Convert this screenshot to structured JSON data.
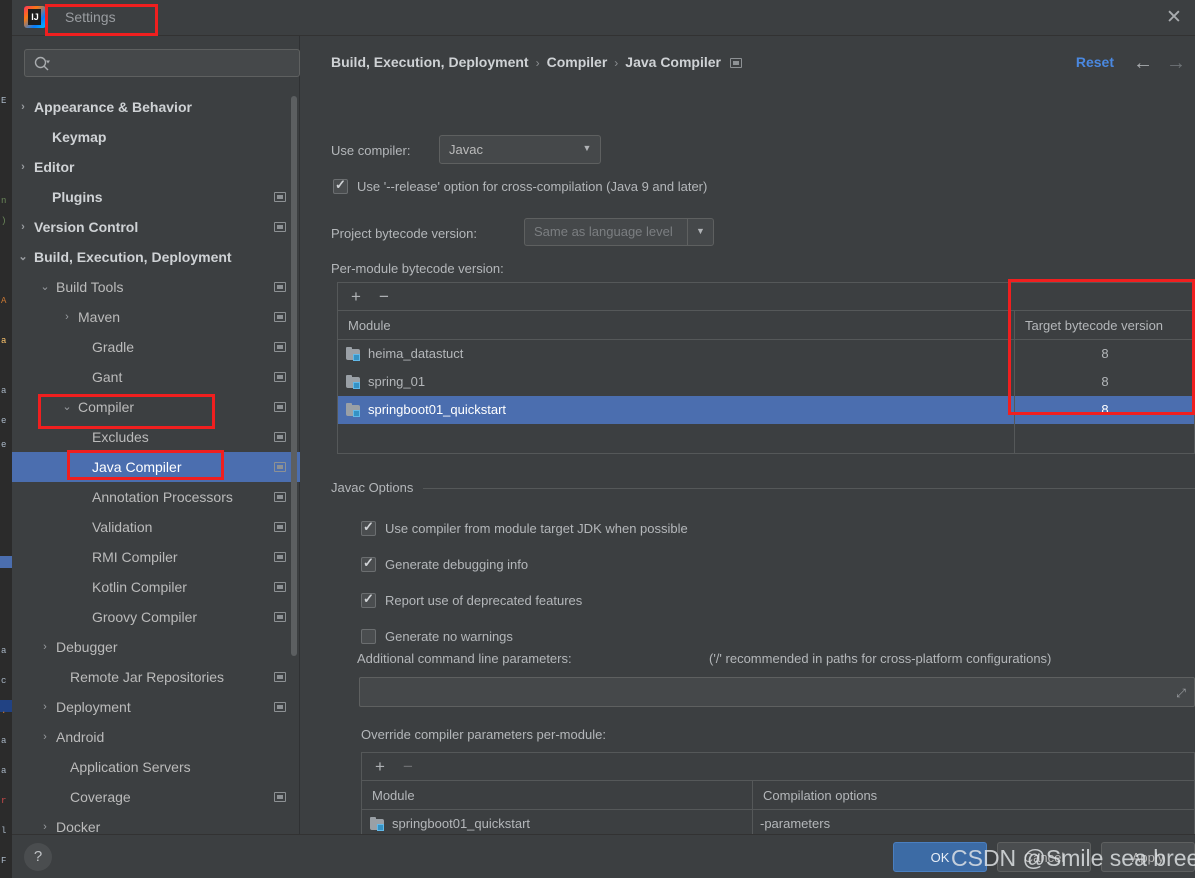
{
  "window": {
    "title": "Settings",
    "logo_text": "IJ",
    "close_label": "✕"
  },
  "sidebar": {
    "search_placeholder": "",
    "items": [
      {
        "label": "Appearance & Behavior",
        "arrow": "›",
        "indent": 22,
        "bold": true,
        "badge": false,
        "selected": false
      },
      {
        "label": "Keymap",
        "arrow": "",
        "indent": 40,
        "bold": true,
        "badge": false,
        "selected": false
      },
      {
        "label": "Editor",
        "arrow": "›",
        "indent": 22,
        "bold": true,
        "badge": false,
        "selected": false
      },
      {
        "label": "Plugins",
        "arrow": "",
        "indent": 40,
        "bold": true,
        "badge": true,
        "selected": false
      },
      {
        "label": "Version Control",
        "arrow": "›",
        "indent": 22,
        "bold": true,
        "badge": true,
        "selected": false
      },
      {
        "label": "Build, Execution, Deployment",
        "arrow": "⌄",
        "indent": 22,
        "bold": true,
        "badge": false,
        "selected": false
      },
      {
        "label": "Build Tools",
        "arrow": "⌄",
        "indent": 44,
        "bold": false,
        "badge": true,
        "selected": false
      },
      {
        "label": "Maven",
        "arrow": "›",
        "indent": 66,
        "bold": false,
        "badge": true,
        "selected": false
      },
      {
        "label": "Gradle",
        "arrow": "",
        "indent": 80,
        "bold": false,
        "badge": true,
        "selected": false
      },
      {
        "label": "Gant",
        "arrow": "",
        "indent": 80,
        "bold": false,
        "badge": true,
        "selected": false
      },
      {
        "label": "Compiler",
        "arrow": "⌄",
        "indent": 66,
        "bold": false,
        "badge": true,
        "selected": false
      },
      {
        "label": "Excludes",
        "arrow": "",
        "indent": 80,
        "bold": false,
        "badge": true,
        "selected": false
      },
      {
        "label": "Java Compiler",
        "arrow": "",
        "indent": 80,
        "bold": false,
        "badge": true,
        "selected": true
      },
      {
        "label": "Annotation Processors",
        "arrow": "",
        "indent": 80,
        "bold": false,
        "badge": true,
        "selected": false
      },
      {
        "label": "Validation",
        "arrow": "",
        "indent": 80,
        "bold": false,
        "badge": true,
        "selected": false
      },
      {
        "label": "RMI Compiler",
        "arrow": "",
        "indent": 80,
        "bold": false,
        "badge": true,
        "selected": false
      },
      {
        "label": "Kotlin Compiler",
        "arrow": "",
        "indent": 80,
        "bold": false,
        "badge": true,
        "selected": false
      },
      {
        "label": "Groovy Compiler",
        "arrow": "",
        "indent": 80,
        "bold": false,
        "badge": true,
        "selected": false
      },
      {
        "label": "Debugger",
        "arrow": "›",
        "indent": 44,
        "bold": false,
        "badge": false,
        "selected": false
      },
      {
        "label": "Remote Jar Repositories",
        "arrow": "",
        "indent": 58,
        "bold": false,
        "badge": true,
        "selected": false
      },
      {
        "label": "Deployment",
        "arrow": "›",
        "indent": 44,
        "bold": false,
        "badge": true,
        "selected": false
      },
      {
        "label": "Android",
        "arrow": "›",
        "indent": 44,
        "bold": false,
        "badge": false,
        "selected": false
      },
      {
        "label": "Application Servers",
        "arrow": "",
        "indent": 58,
        "bold": false,
        "badge": false,
        "selected": false
      },
      {
        "label": "Coverage",
        "arrow": "",
        "indent": 58,
        "bold": false,
        "badge": true,
        "selected": false
      },
      {
        "label": "Docker",
        "arrow": "›",
        "indent": 44,
        "bold": false,
        "badge": false,
        "selected": false
      }
    ]
  },
  "header": {
    "breadcrumb": [
      "Build, Execution, Deployment",
      "Compiler",
      "Java Compiler"
    ],
    "separator": "›",
    "reset_label": "Reset",
    "back_arrow": "←",
    "forward_arrow": "→"
  },
  "main": {
    "use_compiler_label": "Use compiler:",
    "use_compiler_value": "Javac",
    "release_option_label": "Use '--release' option for cross-compilation (Java 9 and later)",
    "release_option_checked": true,
    "project_bytecode_label": "Project bytecode version:",
    "project_bytecode_value": "Same as language level",
    "per_module_label": "Per-module bytecode version:",
    "add_button": "+",
    "remove_button": "−",
    "bytecode_table": {
      "columns": [
        "Module",
        "Target bytecode version"
      ],
      "rows": [
        {
          "module": "heima_datastuct",
          "version": "8",
          "selected": false
        },
        {
          "module": "spring_01",
          "version": "8",
          "selected": false
        },
        {
          "module": "springboot01_quickstart",
          "version": "8",
          "selected": true
        }
      ]
    },
    "javac_options_title": "Javac Options",
    "javac_checkboxes": [
      {
        "label": "Use compiler from module target JDK when possible",
        "checked": true
      },
      {
        "label": "Generate debugging info",
        "checked": true
      },
      {
        "label": "Report use of deprecated features",
        "checked": true
      },
      {
        "label": "Generate no warnings",
        "checked": false
      }
    ],
    "additional_params_label": "Additional command line parameters:",
    "additional_params_hint": "('/' recommended in paths for cross-platform configurations)",
    "additional_params_value": "",
    "override_label": "Override compiler parameters per-module:",
    "override_table": {
      "columns": [
        "Module",
        "Compilation options"
      ],
      "rows": [
        {
          "module": "springboot01_quickstart",
          "options": "-parameters"
        }
      ]
    }
  },
  "footer": {
    "help_label": "?",
    "ok_label": "OK",
    "cancel_label": "Cancel",
    "apply_label": "Apply"
  },
  "watermark": {
    "text": "CSDN @Smile sea breeze"
  },
  "colors": {
    "accent_blue": "#4b6eaf",
    "link_blue": "#4a88e0",
    "annotation_red": "#f01f1f",
    "panel_bg": "#3c3f41"
  }
}
